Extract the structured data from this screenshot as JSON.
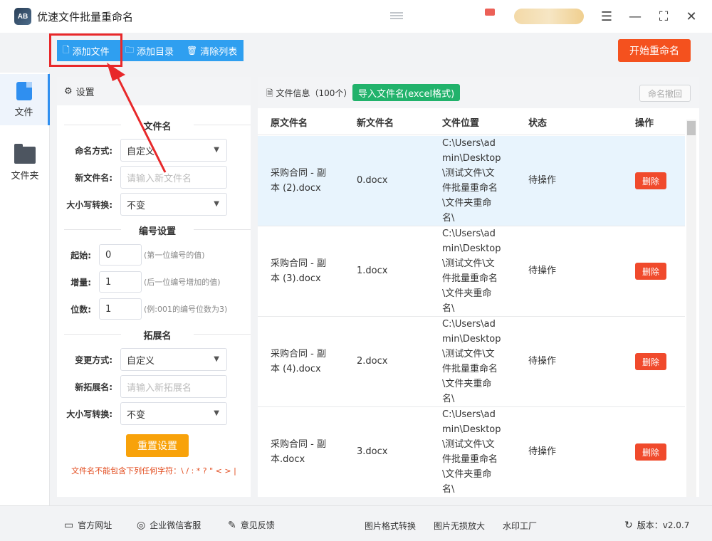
{
  "app": {
    "title": "优速文件批量重命名",
    "logo_text": "AB"
  },
  "window_controls": {
    "menu_icon": "menu-icon",
    "minimize_icon": "minimize-icon",
    "maximize_icon": "fullscreen-icon",
    "close_icon": "close-icon"
  },
  "toolbar": {
    "add_file": "添加文件",
    "add_dir": "添加目录",
    "clear_list": "清除列表",
    "start": "开始重命名"
  },
  "nav": {
    "items": [
      {
        "label": "文件",
        "icon": "file-icon"
      },
      {
        "label": "文件夹",
        "icon": "folder-icon"
      }
    ]
  },
  "settings": {
    "title": "设置",
    "filename": {
      "section": "文件名",
      "mode_label": "命名方式:",
      "mode_value": "自定义",
      "newname_label": "新文件名:",
      "newname_placeholder": "请输入新文件名",
      "case_label": "大小写转换:",
      "case_value": "不变"
    },
    "numbering": {
      "section": "编号设置",
      "start_label": "起始:",
      "start_value": "0",
      "start_hint": "(第一位编号的值)",
      "step_label": "增量:",
      "step_value": "1",
      "step_hint": "(后一位编号增加的值)",
      "digits_label": "位数:",
      "digits_value": "1",
      "digits_hint": "(例:001的编号位数为3)"
    },
    "extension": {
      "section": "拓展名",
      "mode_label": "变更方式:",
      "mode_value": "自定义",
      "newext_label": "新拓展名:",
      "newext_placeholder": "请输入新拓展名",
      "case_label": "大小写转换:",
      "case_value": "不变"
    },
    "reset": "重置设置",
    "warning": "文件名不能包含下列任何字符：\\ / : * ? \" < > |"
  },
  "files": {
    "info": "文件信息（100个）",
    "import_btn": "导入文件名(excel格式)",
    "undo": "命名撤回",
    "columns": [
      "原文件名",
      "新文件名",
      "文件位置",
      "状态",
      "操作"
    ],
    "rows": [
      {
        "original": [
          "采购合同 - 副",
          "本 (2).docx"
        ],
        "newname": "0.docx",
        "location": [
          "C:\\Users\\ad",
          "min\\Desktop",
          "\\测试文件\\文",
          "件批量重命名",
          "\\文件夹重命",
          "名\\"
        ],
        "status": "待操作",
        "action": "删除"
      },
      {
        "original": [
          "采购合同 - 副",
          "本 (3).docx"
        ],
        "newname": "1.docx",
        "location": [
          "C:\\Users\\ad",
          "min\\Desktop",
          "\\测试文件\\文",
          "件批量重命名",
          "\\文件夹重命",
          "名\\"
        ],
        "status": "待操作",
        "action": "删除"
      },
      {
        "original": [
          "采购合同 - 副",
          "本 (4).docx"
        ],
        "newname": "2.docx",
        "location": [
          "C:\\Users\\ad",
          "min\\Desktop",
          "\\测试文件\\文",
          "件批量重命名",
          "\\文件夹重命",
          "名\\"
        ],
        "status": "待操作",
        "action": "删除"
      },
      {
        "original": [
          "采购合同 - 副",
          "本.docx"
        ],
        "newname": "3.docx",
        "location": [
          "C:\\Users\\ad",
          "min\\Desktop",
          "\\测试文件\\文",
          "件批量重命名",
          "\\文件夹重命",
          "名\\"
        ],
        "status": "待操作",
        "action": "删除"
      }
    ]
  },
  "footer": {
    "website": "官方网址",
    "wechat": "企业微信客服",
    "feedback": "意见反馈",
    "img_convert": "图片格式转换",
    "img_enlarge": "图片无损放大",
    "watermark": "水印工厂",
    "version": "版本：v2.0.7"
  },
  "colors": {
    "accent": "#2f9ff0",
    "start": "#f4511e",
    "import": "#21b26b",
    "delete": "#f04a2c",
    "reset": "#f8a20a",
    "highlight": "#e8282a"
  }
}
